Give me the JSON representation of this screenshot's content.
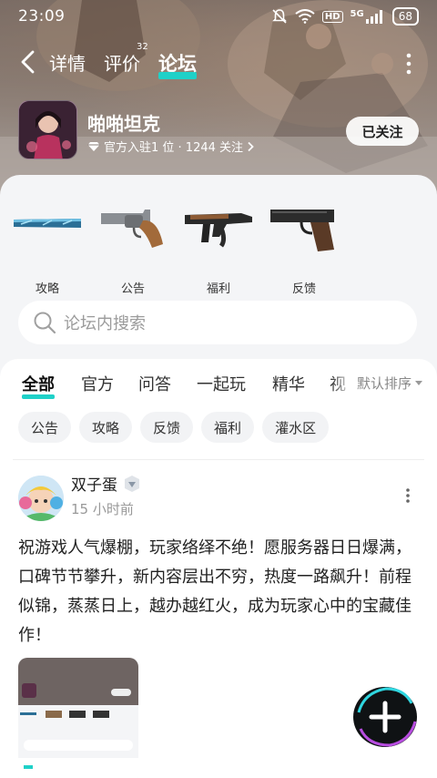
{
  "status_bar": {
    "time": "23:09",
    "network": "5G",
    "hd": "HD",
    "battery": "68"
  },
  "nav": {
    "tabs": [
      {
        "label": "详情"
      },
      {
        "label": "评价",
        "badge": "32"
      },
      {
        "label": "论坛"
      }
    ]
  },
  "game": {
    "title": "啪啪坦克",
    "meta": "官方入驻1 位 · 1244 关注",
    "follow_label": "已关注"
  },
  "categories": [
    {
      "label": "攻略",
      "icon": "blue-bat-icon"
    },
    {
      "label": "公告",
      "icon": "revolver-icon"
    },
    {
      "label": "福利",
      "icon": "rifle-icon"
    },
    {
      "label": "反馈",
      "icon": "pistol-icon"
    }
  ],
  "search": {
    "placeholder": "论坛内搜索"
  },
  "subtabs": [
    "全部",
    "官方",
    "问答",
    "一起玩",
    "精华",
    "视"
  ],
  "sort_label": "默认排序",
  "chips": [
    "公告",
    "攻略",
    "反馈",
    "福利",
    "灌水区"
  ],
  "post": {
    "author": "双子蛋",
    "time": "15 小时前",
    "body": "祝游戏人气爆棚，玩家络绎不绝！愿服务器日日爆满，口碑节节攀升，新内容层出不穷，热度一路飙升！前程似锦，蒸蒸日上，越办越红火，成为玩家心中的宝藏佳作！"
  },
  "colors": {
    "accent": "#1fd1c8",
    "background": "#f4f5f7"
  }
}
